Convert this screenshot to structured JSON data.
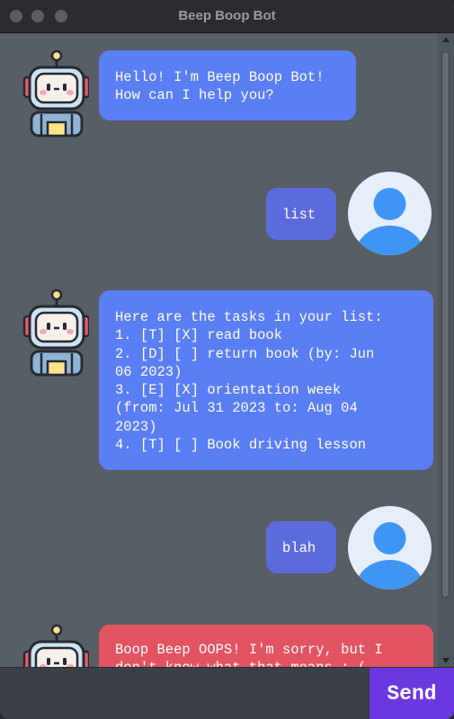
{
  "window": {
    "title": "Beep Boop Bot"
  },
  "messages": {
    "m1": "Hello! I'm Beep Boop Bot!\nHow can I help you?",
    "m2": "list",
    "m3": "Here are the tasks in your list:\n1. [T] [X] read book\n2. [D] [ ] return book (by: Jun\n06 2023)\n3. [E] [X] orientation week\n(from: Jul 31 2023 to: Aug 04\n2023)\n4. [T] [ ] Book driving lesson",
    "m4": "blah",
    "m5": "Boop Beep OOPS! I'm sorry, but I\ndon't know what that means :-("
  },
  "input": {
    "value": "",
    "placeholder": ""
  },
  "send": {
    "label": "Send"
  },
  "colors": {
    "bot_bubble": "#5a7ef3",
    "user_bubble": "#5c6bdc",
    "error_bubble": "#e35463",
    "send_button": "#6b38e0"
  }
}
